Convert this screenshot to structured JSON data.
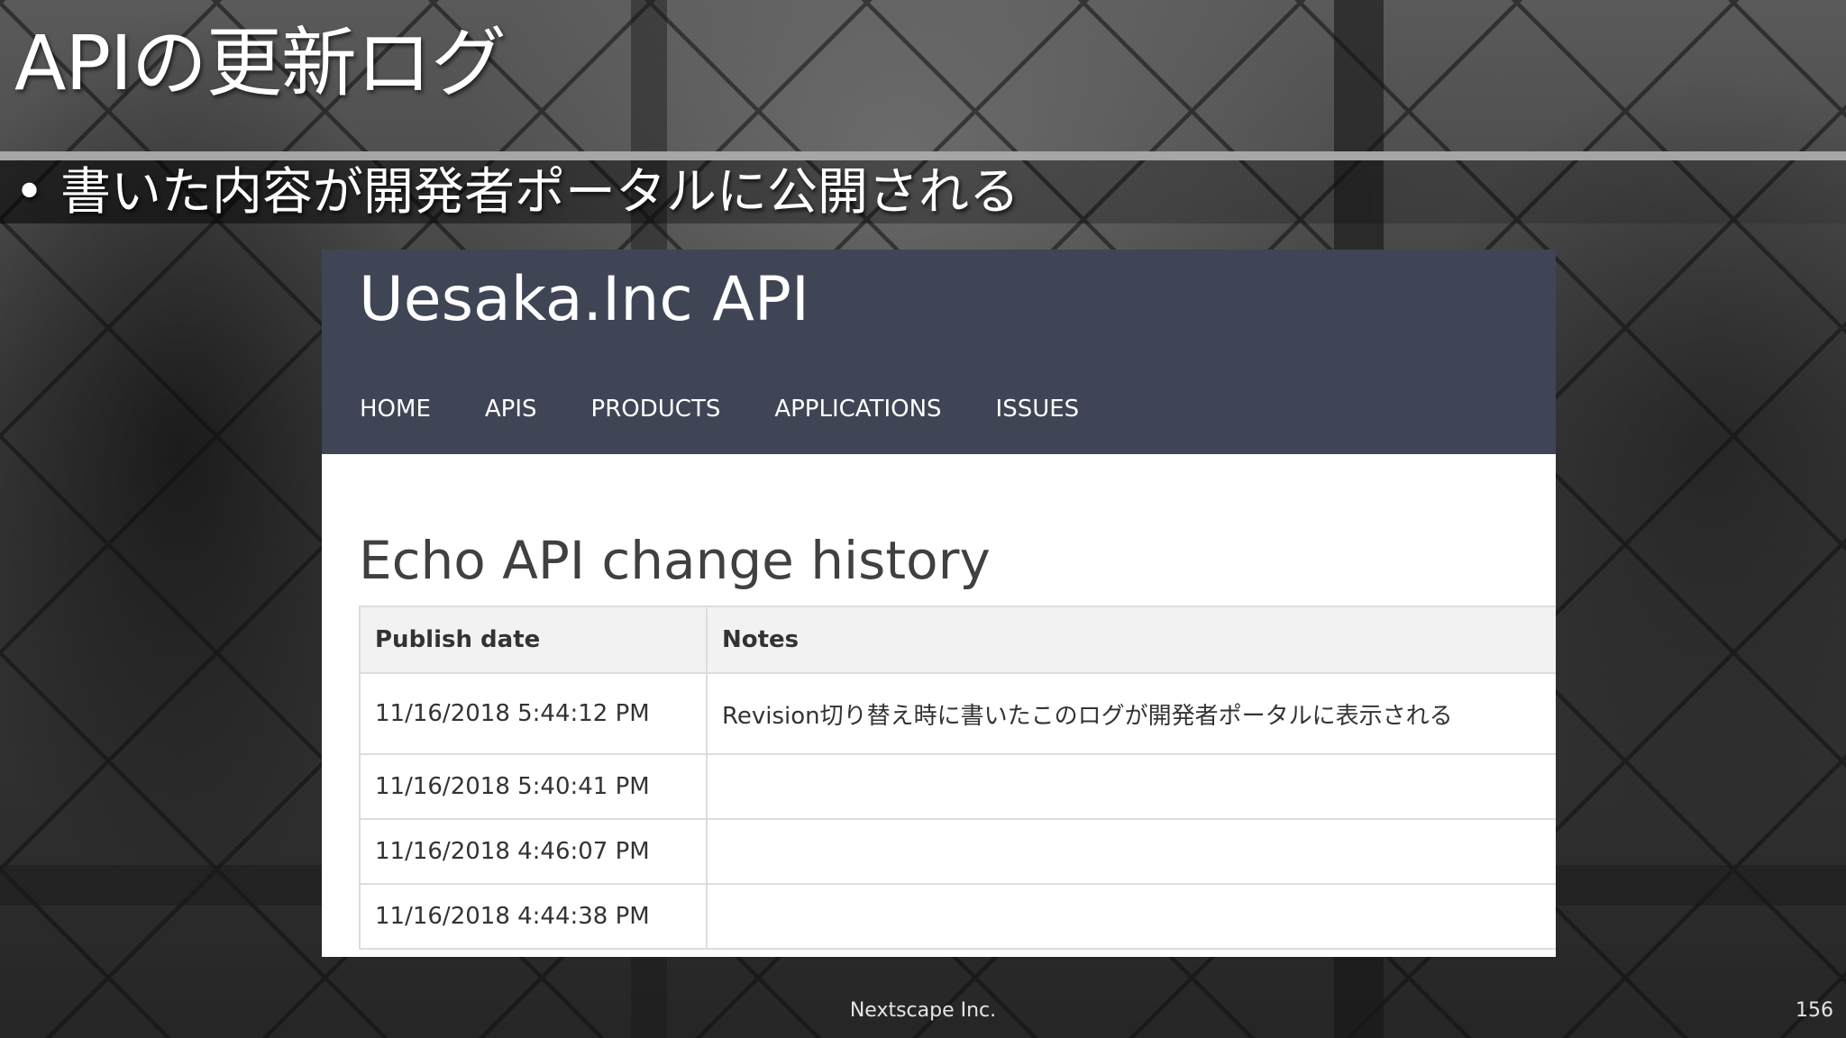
{
  "slide": {
    "title": "APIの更新ログ",
    "bullet_marker": "•",
    "bullet": "書いた内容が開発者ポータルに公開される"
  },
  "portal": {
    "brand": "Uesaka.Inc API",
    "nav": [
      {
        "label": "HOME"
      },
      {
        "label": "APIS"
      },
      {
        "label": "PRODUCTS"
      },
      {
        "label": "APPLICATIONS"
      },
      {
        "label": "ISSUES"
      }
    ],
    "heading": "Echo API change history",
    "table": {
      "headers": [
        "Publish date",
        "Notes"
      ],
      "rows": [
        {
          "date": "11/16/2018 5:44:12 PM",
          "notes": "Revision切り替え時に書いたこのログが開発者ポータルに表示される"
        },
        {
          "date": "11/16/2018 5:40:41 PM",
          "notes": ""
        },
        {
          "date": "11/16/2018 4:46:07 PM",
          "notes": ""
        },
        {
          "date": "11/16/2018 4:44:38 PM",
          "notes": ""
        }
      ]
    }
  },
  "footer": {
    "company": "Nextscape Inc.",
    "page_number": "156"
  },
  "colors": {
    "portal_header": "#3f4555",
    "title_rule": "#a6a6a6",
    "table_header_bg": "#f2f2f2"
  }
}
